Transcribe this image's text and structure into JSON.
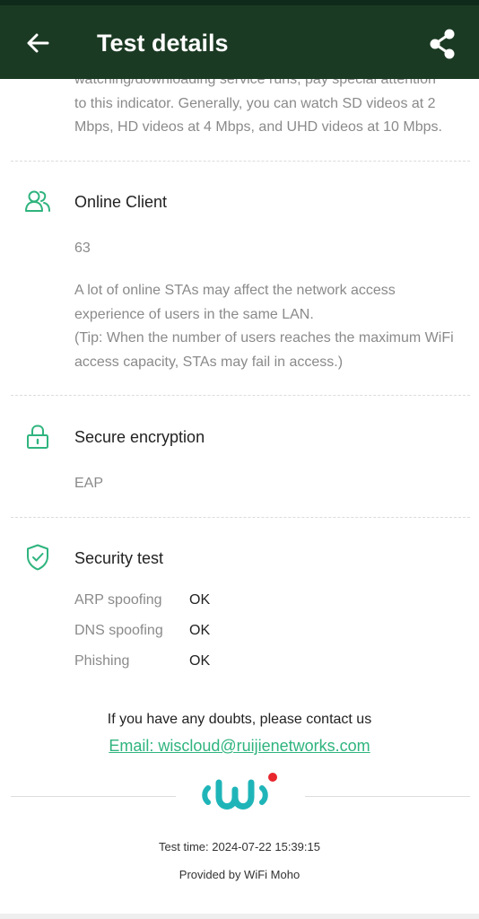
{
  "app_bar": {
    "title": "Test details",
    "back_icon": "arrow-left-icon",
    "share_icon": "share-icon"
  },
  "bandwidth": {
    "description_lines": [
      "watching/downloading service runs, pay special attention",
      "to this indicator. Generally, you can watch SD videos at 2",
      "Mbps, HD videos at 4 Mbps, and UHD videos at 10 Mbps."
    ]
  },
  "online_client": {
    "icon": "users-icon",
    "title": "Online Client",
    "value": "63",
    "description_lines": [
      "A lot of online STAs may affect the network access",
      "experience of users in the same LAN.",
      "(Tip: When the number of users reaches the maximum WiFi",
      "access capacity, STAs may fail in access.)"
    ]
  },
  "encryption": {
    "icon": "lock-icon",
    "title": "Secure encryption",
    "value": "EAP"
  },
  "security_test": {
    "icon": "shield-check-icon",
    "title": "Security test",
    "items": [
      {
        "label": "ARP spoofing",
        "value": "OK"
      },
      {
        "label": "DNS spoofing",
        "value": "OK"
      },
      {
        "label": "Phishing",
        "value": "OK"
      }
    ]
  },
  "contact": {
    "text": "If you have any doubts, please contact us",
    "email_link": "Email: wiscloud@ruijienetworks.com"
  },
  "footer": {
    "logo": "wifi-moho-logo",
    "test_time": "Test time: 2024-07-22 15:39:15",
    "provided_by": "Provided by WiFi Moho"
  },
  "colors": {
    "app_bar": "#1b3a23",
    "accent_green": "#2fb47e",
    "logo_teal": "#1fb5b8",
    "logo_red": "#e8262d"
  }
}
